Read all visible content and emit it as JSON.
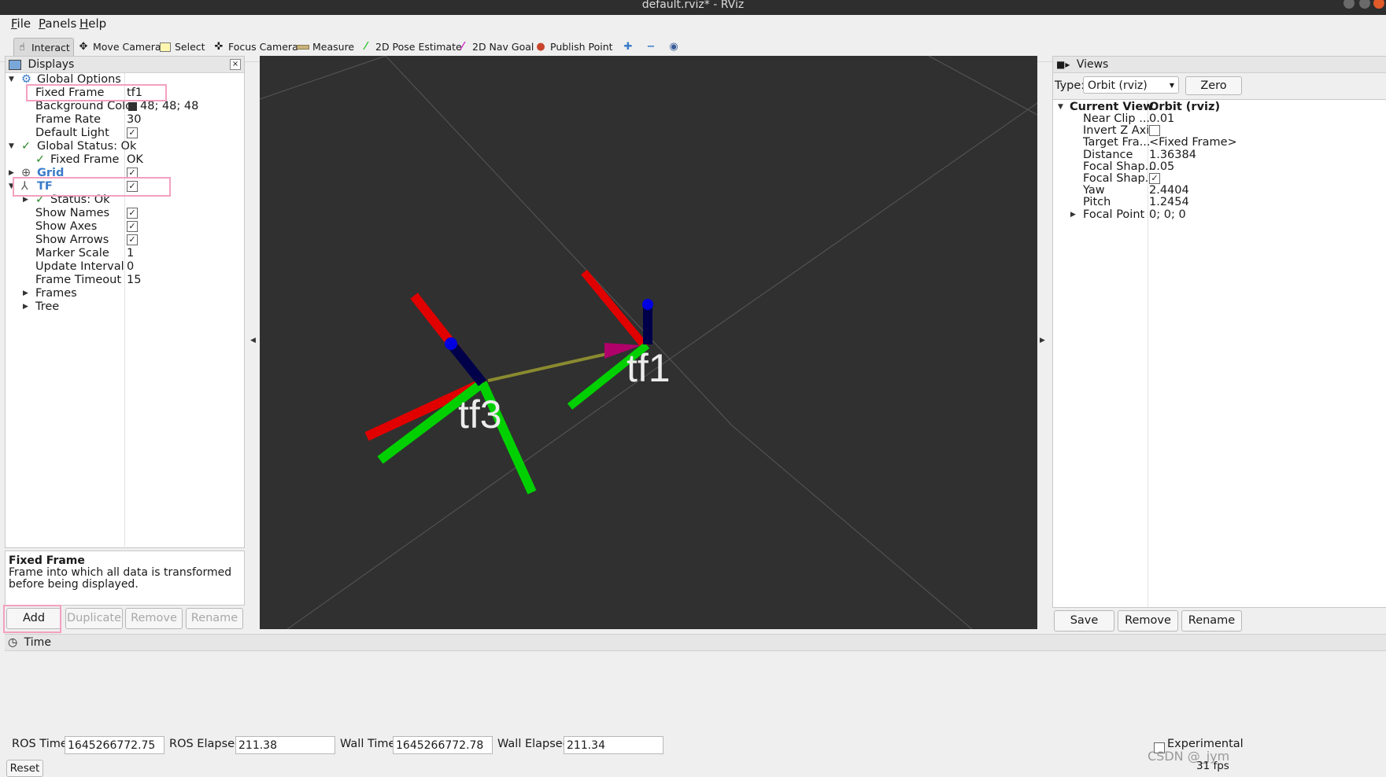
{
  "window": {
    "title": "default.rviz* - RViz"
  },
  "menu": {
    "file": "File",
    "file_u": "F",
    "file_rest": "ile",
    "panels": "Panels",
    "panels_u": "P",
    "panels_rest": "anels",
    "help": "Help",
    "help_u": "H",
    "help_rest": "elp"
  },
  "toolbar": {
    "interact": "Interact",
    "move_camera": "Move Camera",
    "select": "Select",
    "focus_camera": "Focus Camera",
    "measure": "Measure",
    "pose_estimate": "2D Pose Estimate",
    "nav_goal": "2D Nav Goal",
    "publish_point": "Publish Point"
  },
  "displays": {
    "title": "Displays",
    "global_options": "Global Options",
    "fixed_frame_label": "Fixed Frame",
    "fixed_frame_value": "tf1",
    "bg_color_label": "Background Color",
    "bg_color_value": "48; 48; 48",
    "bg_color_swatch": "#303030",
    "frame_rate_label": "Frame Rate",
    "frame_rate_value": "30",
    "default_light_label": "Default Light",
    "global_status": "Global Status: Ok",
    "gs_fixed_frame_label": "Fixed Frame",
    "gs_fixed_frame_value": "OK",
    "grid": "Grid",
    "tf": "TF",
    "tf_status": "Status: Ok",
    "show_names": "Show Names",
    "show_axes": "Show Axes",
    "show_arrows": "Show Arrows",
    "marker_scale_label": "Marker Scale",
    "marker_scale_value": "1",
    "update_interval_label": "Update Interval",
    "update_interval_value": "0",
    "frame_timeout_label": "Frame Timeout",
    "frame_timeout_value": "15",
    "frames": "Frames",
    "tree": "Tree",
    "check_glyph": "✓"
  },
  "description": {
    "title": "Fixed Frame",
    "text": "Frame into which all data is transformed before being displayed."
  },
  "display_buttons": {
    "add": "Add",
    "duplicate": "Duplicate",
    "remove": "Remove",
    "rename": "Rename"
  },
  "viewport": {
    "background": "#303030",
    "frame_a": "tf3",
    "frame_b": "tf1"
  },
  "views": {
    "title": "Views",
    "type_label": "Type:",
    "type_value": "Orbit (rviz)",
    "zero": "Zero",
    "current_view": "Current View",
    "current_view_value": "Orbit (rviz)",
    "props": [
      {
        "k": "Near Clip ...",
        "v": "0.01"
      },
      {
        "k": "Invert Z Axis",
        "v": ""
      },
      {
        "k": "Target Fra...",
        "v": "<Fixed Frame>"
      },
      {
        "k": "Distance",
        "v": "1.36384"
      },
      {
        "k": "Focal Shap...",
        "v": "0.05"
      },
      {
        "k": "Focal Shap...",
        "v": ""
      },
      {
        "k": "Yaw",
        "v": "2.4404"
      },
      {
        "k": "Pitch",
        "v": "1.2454"
      },
      {
        "k": "Focal Point",
        "v": "0; 0; 0"
      }
    ],
    "save": "Save",
    "remove": "Remove",
    "rename": "Rename"
  },
  "time": {
    "title": "Time",
    "ros_time_label": "ROS Time:",
    "ros_time": "1645266772.75",
    "ros_elapsed_label": "ROS Elapsed:",
    "ros_elapsed": "211.38",
    "wall_time_label": "Wall Time:",
    "wall_time": "1645266772.78",
    "wall_elapsed_label": "Wall Elapsed:",
    "wall_elapsed": "211.34",
    "experimental": "Experimental",
    "reset": "Reset",
    "fps": "31 fps",
    "watermark": "CSDN @_jym"
  }
}
